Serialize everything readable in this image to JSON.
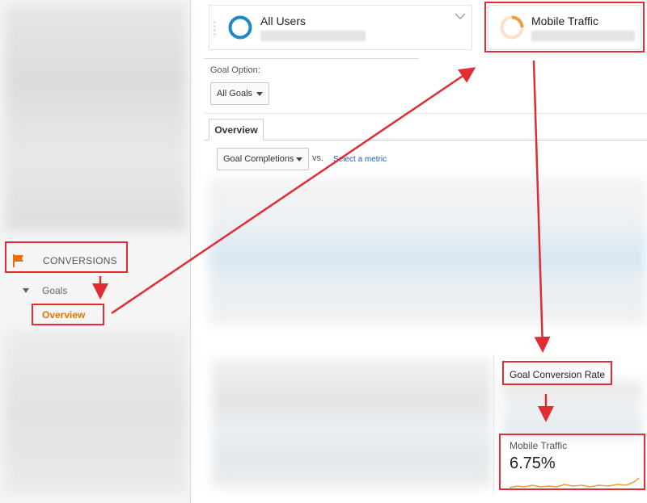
{
  "sidebar": {
    "conversions_label": "CONVERSIONS",
    "goals_label": "Goals",
    "overview_label": "Overview"
  },
  "segments": {
    "all_users": {
      "title": "All Users"
    },
    "mobile_traffic": {
      "title": "Mobile Traffic"
    }
  },
  "goal_option": {
    "label": "Goal Option:",
    "selected": "All Goals"
  },
  "tabs": [
    {
      "label": "Overview"
    }
  ],
  "metric": {
    "selected": "Goal Completions",
    "vs_label": "vs.",
    "select_metric_link": "Select a metric"
  },
  "kpi": {
    "title": "Goal Conversion Rate",
    "segment": "Mobile Traffic",
    "value": "6.75%"
  },
  "colors": {
    "accent_orange": "#e8710a",
    "all_users_donut": "#1e88c7",
    "mobile_donut": "#f19a3e",
    "annotation_red": "#e02c32",
    "link_blue": "#1a5db8"
  }
}
